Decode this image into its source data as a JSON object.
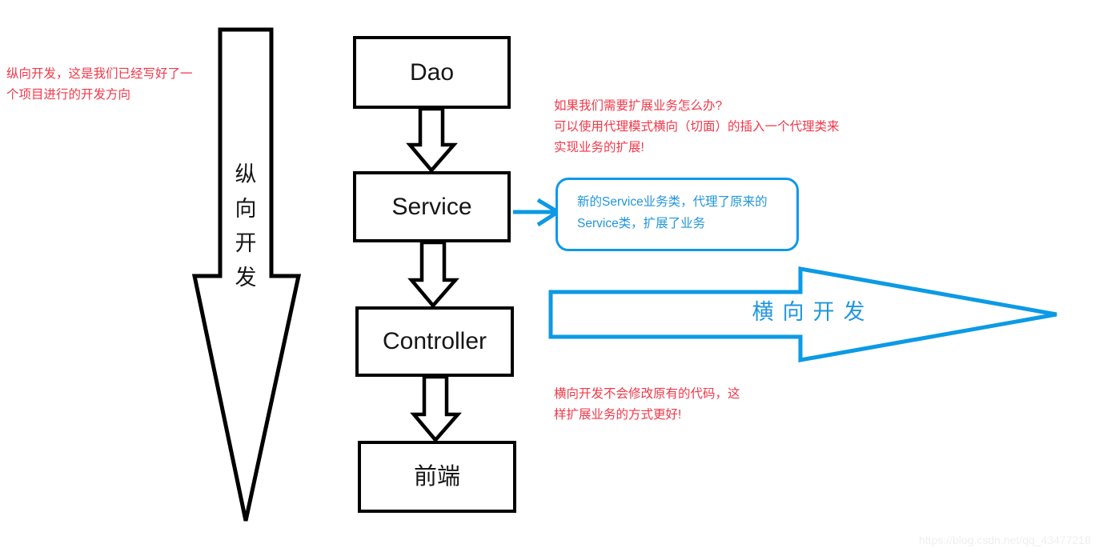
{
  "diagram": {
    "title_watermark": "https://blog.csdn.net/qq_43477218",
    "colors": {
      "outline_black": "#000000",
      "accent_blue": "#0c9ae5",
      "text_blue": "#2196dd",
      "note_red": "#f23849",
      "background": "#ffffff",
      "watermark_gray": "#efefef"
    },
    "nodes": [
      {
        "id": "dao",
        "label": "Dao"
      },
      {
        "id": "service",
        "label": "Service"
      },
      {
        "id": "controller",
        "label": "Controller"
      },
      {
        "id": "frontend",
        "label": "前端"
      }
    ],
    "vertical_arrow": {
      "label": "纵向开发",
      "direction": "down"
    },
    "horizontal_arrow": {
      "label": "横向开发",
      "direction": "right"
    },
    "callout": {
      "text": "新的Service业务类，代理了原来的\nService类，扩展了业务"
    },
    "notes": [
      {
        "id": "vertical-note",
        "text": "纵向开发，这是我们已经写好了一\n个项目进行的开发方向"
      },
      {
        "id": "expand-note",
        "text": "如果我们需要扩展业务怎么办?\n可以使用代理模式横向（切面）的插入一个代理类来\n实现业务的扩展!"
      },
      {
        "id": "horizontal-note",
        "text": "横向开发不会修改原有的代码，这\n样扩展业务的方式更好!"
      }
    ]
  }
}
